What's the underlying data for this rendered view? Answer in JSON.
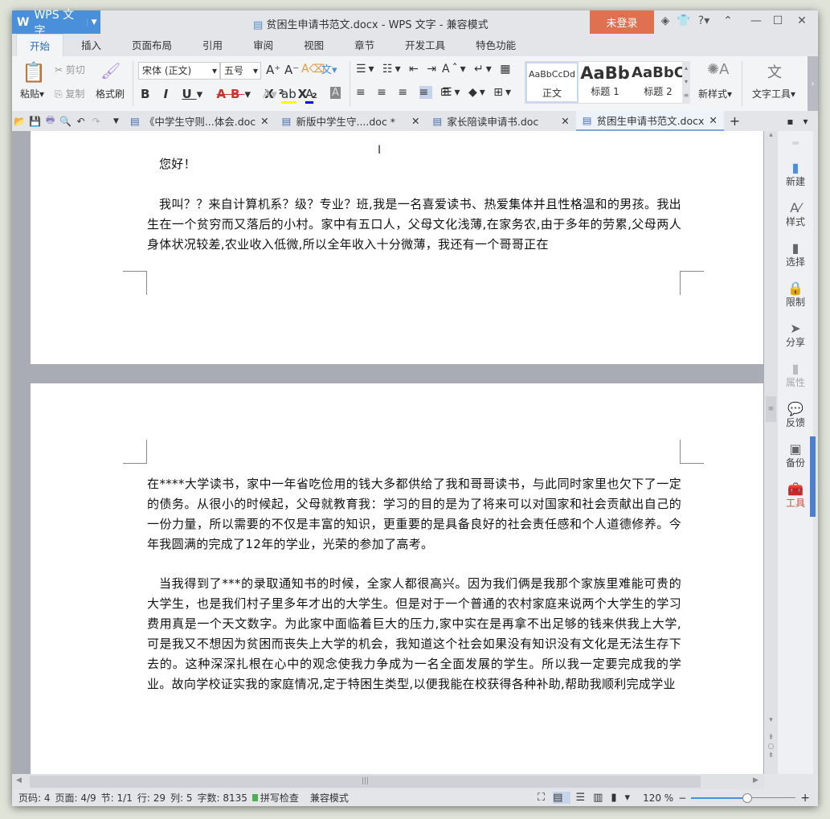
{
  "app": {
    "name": "WPS 文字",
    "title": "贫困生申请书范文.docx - WPS 文字 - 兼容模式",
    "login": "未登录"
  },
  "menu_tabs": [
    "开始",
    "插入",
    "页面布局",
    "引用",
    "审阅",
    "视图",
    "章节",
    "开发工具",
    "特色功能"
  ],
  "ribbon": {
    "paste": "粘贴",
    "cut": "剪切",
    "copy": "复制",
    "format_painter": "格式刷",
    "font_name": "宋体 (正文)",
    "font_size": "五号",
    "styles": [
      {
        "preview": "AaBbCcDd",
        "label": "正文"
      },
      {
        "preview": "AaBb",
        "label": "标题 1"
      },
      {
        "preview": "AaBbC",
        "label": "标题 2"
      }
    ],
    "new_style": "新样式",
    "text_tools": "文字工具"
  },
  "doc_tabs": [
    {
      "label": "《中学生守则...体会.doc",
      "active": false
    },
    {
      "label": "新版中学生守....doc *",
      "active": false
    },
    {
      "label": "家长陪读申请书.doc",
      "active": false
    },
    {
      "label": "贫困生申请书范文.docx",
      "active": true
    }
  ],
  "document": {
    "page1": [
      "您好！",
      "我叫？？来自计算机系？级？专业？班,我是一名喜爱读书、热爱集体并且性格温和的男孩。我出生在一个贫穷而又落后的小村。家中有五口人，父母文化浅薄,在家务农,由于多年的劳累,父母两人身体状况较差,农业收入低微,所以全年收入十分微薄，我还有一个哥哥正在"
    ],
    "page2": [
      "在****大学读书，家中一年省吃俭用的钱大多都供给了我和哥哥读书，与此同时家里也欠下了一定的债务。从很小的时候起，父母就教育我：学习的目的是为了将来可以对国家和社会贡献出自己的一份力量，所以需要的不仅是丰富的知识，更重要的是具备良好的社会责任感和个人道德修养。今年我圆满的完成了12年的学业，光荣的参加了高考。",
      "当我得到了***的录取通知书的时候，全家人都很高兴。因为我们俩是我那个家族里难能可贵的大学生，也是我们村子里多年才出的大学生。但是对于一个普通的农村家庭来说两个大学生的学习费用真是一个天文数字。为此家中面临着巨大的压力,家中实在是再拿不出足够的钱来供我上大学,可是我又不想因为贫困而丧失上大学的机会，我知道这个社会如果没有知识没有文化是无法生存下去的。这种深深扎根在心中的观念使我力争成为一名全面发展的学生。所以我一定要完成我的学业。故向学校证实我的家庭情况,定于特困生类型,以便我能在校获得各种补助,帮助我顺利完成学业"
    ]
  },
  "right_panel": [
    "新建",
    "样式",
    "选择",
    "限制",
    "分享",
    "属性",
    "反馈",
    "备份",
    "工具"
  ],
  "status": {
    "page_no": "页码: 4",
    "pages": "页面: 4/9",
    "section": "节: 1/1",
    "row": "行: 29",
    "col": "列: 5",
    "words": "字数: 8135",
    "spell": "拼写检查",
    "mode": "兼容模式",
    "zoom": "120 %",
    "zoom_percent": 120
  },
  "colors": {
    "brand": "#4a8fd9",
    "login": "#e07150",
    "tools": "#c4513a"
  }
}
